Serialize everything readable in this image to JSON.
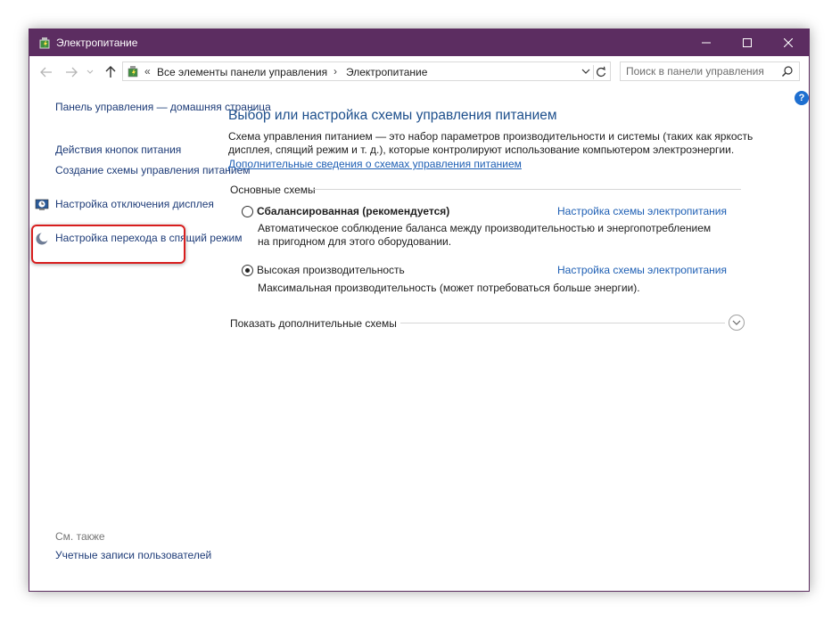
{
  "window": {
    "title": "Электропитание",
    "accent": "#5c2d61"
  },
  "address": {
    "back_arrow": "←",
    "crumb_1": "Все элементы панели управления",
    "crumb_2": "Электропитание",
    "chevron": "«",
    "separator": "›"
  },
  "search": {
    "placeholder": "Поиск в панели управления"
  },
  "help": "?",
  "sidebar": {
    "home_line1": "Панель управления —",
    "home_line2": "домашняя страница",
    "power_buttons": "Действия кнопок питания",
    "create_plan_line1": "Создание схемы управления",
    "create_plan_line2": "питанием",
    "display_off_line1": "Настройка отключения",
    "display_off_line2": "дисплея",
    "sleep_line1": "Настройка перехода в",
    "sleep_line2": "спящий режим",
    "see_also": "См. также",
    "accounts_line1": "Учетные записи",
    "accounts_line2": "пользователей"
  },
  "main": {
    "title": "Выбор или настройка схемы управления питанием",
    "desc_line1": "Схема управления питанием — это набор параметров производительности и системы (таких как яркость",
    "desc_line2": "дисплея, спящий режим и т. д.), которые контролируют использование компьютером электроэнергии.",
    "desc_link": "Дополнительные сведения о схемах управления питанием",
    "section_label": "Основные схемы",
    "plans": [
      {
        "name": "Сбалансированная (рекомендуется)",
        "link": "Настройка схемы электропитания",
        "desc_line1": "Автоматическое соблюдение баланса между производительностью и энергопотреблением",
        "desc_line2": "на пригодном для этого оборудовании.",
        "selected": false
      },
      {
        "name": "Высокая производительность",
        "link": "Настройка схемы электропитания",
        "desc_line1": "Максимальная производительность (может потребоваться больше энергии).",
        "selected": true
      }
    ],
    "more_label": "Показать дополнительные схемы"
  }
}
